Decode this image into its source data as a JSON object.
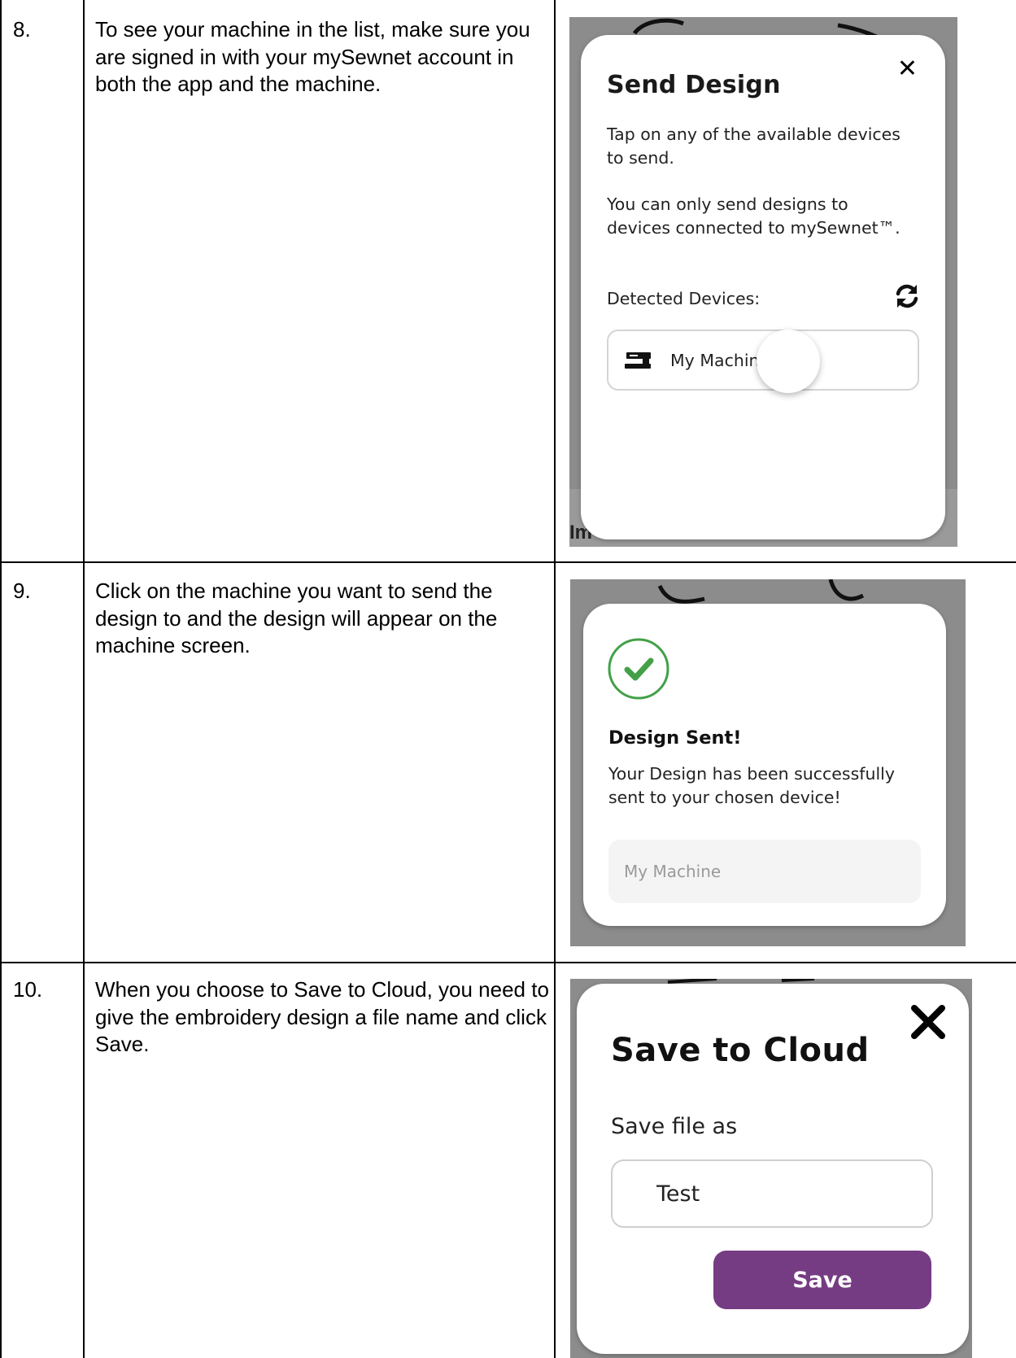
{
  "rows": [
    {
      "number": "8.",
      "text": "To see your machine in the list, make sure you are signed in with your mySewnet account in both the app and the machine.",
      "screenshot": {
        "title": "Send Design",
        "close": "✕",
        "paragraph1": "Tap on any of the available devices to send.",
        "paragraph2": "You can only send designs to devices connected to mySewnet™.",
        "detected_label": "Detected Devices:",
        "device_label": "My Machine",
        "background_text": "Im",
        "icons": [
          "close-icon",
          "refresh-icon",
          "sewing-machine-icon"
        ]
      }
    },
    {
      "number": "9.",
      "text": "Click on the machine you want to send the design to and the design will appear on the machine screen.",
      "screenshot": {
        "title": "Design Sent!",
        "message": "Your Design has been successfully sent to your chosen device!",
        "device_label": "My Machine",
        "check_color": "#43a047",
        "icons": [
          "check-circle-icon"
        ]
      }
    },
    {
      "number": "10.",
      "text": "When you choose to Save to Cloud, you need to give the embroidery design a file name and click Save.",
      "screenshot": {
        "title": "Save to Cloud",
        "field_label": "Save file as",
        "field_value": "Test",
        "save_label": "Save",
        "save_color": "#763c83",
        "icons": [
          "close-icon"
        ]
      }
    }
  ]
}
